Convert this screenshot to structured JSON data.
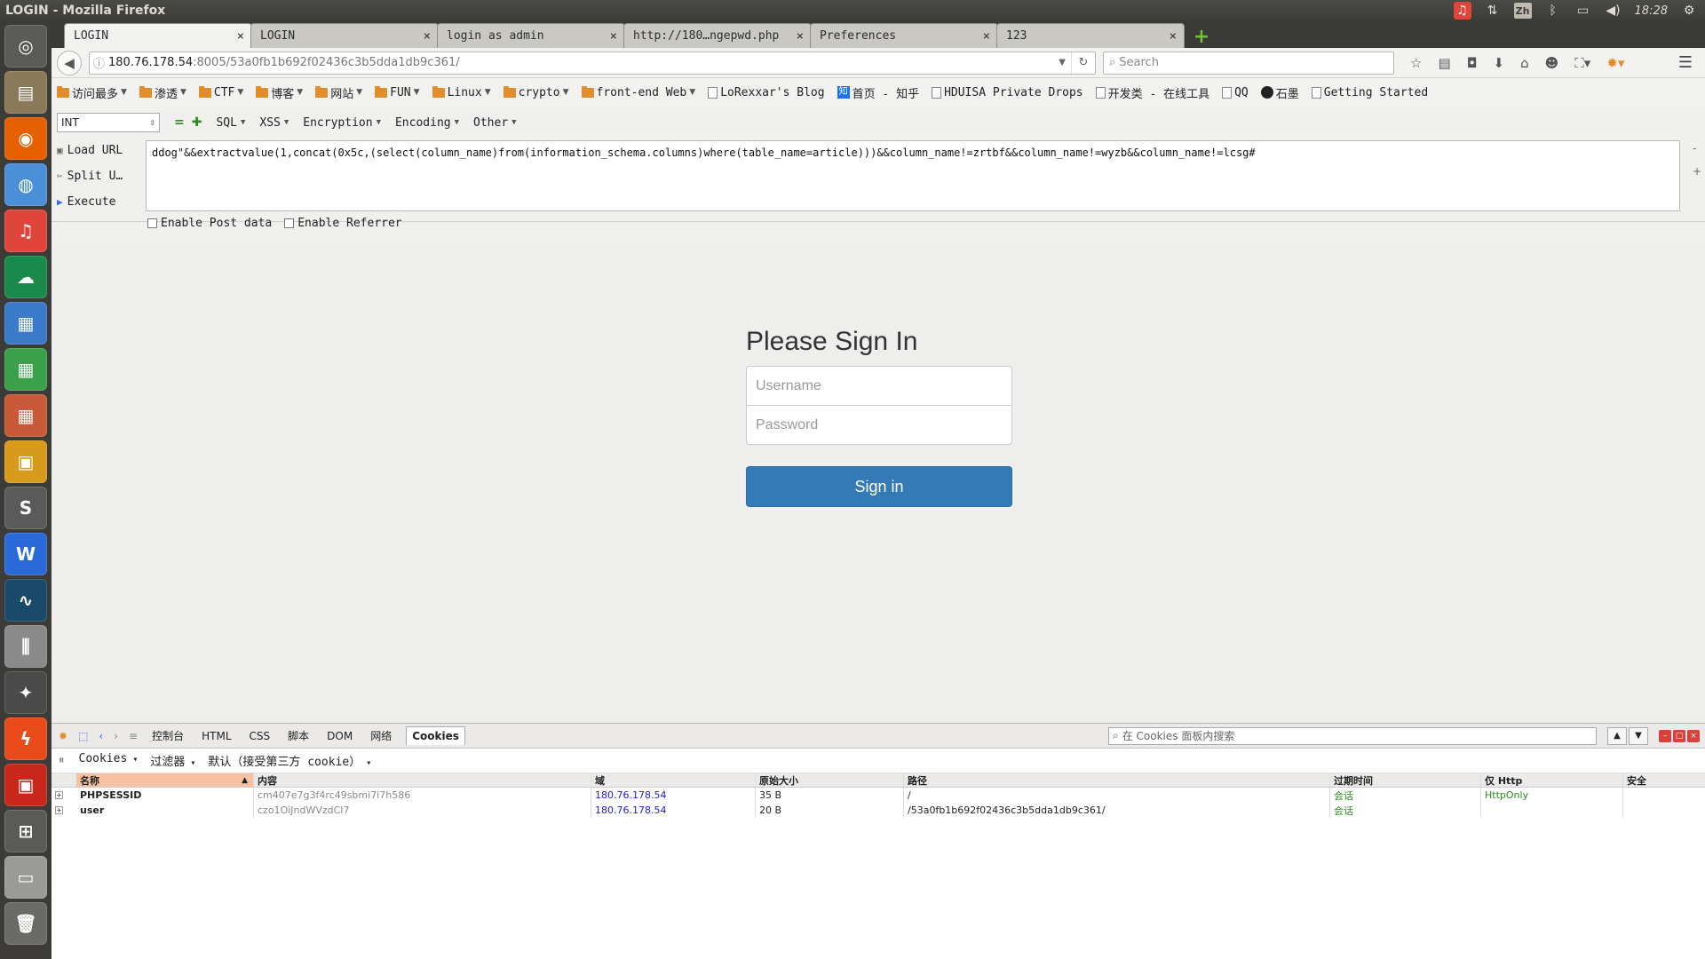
{
  "window": {
    "title": "LOGIN - Mozilla Firefox"
  },
  "tray": {
    "input_method": "Zh",
    "time": "18:28"
  },
  "tabs": [
    {
      "label": "LOGIN",
      "active": true
    },
    {
      "label": "LOGIN"
    },
    {
      "label": "login as admin"
    },
    {
      "label": "http://180…ngepwd.php"
    },
    {
      "label": "Preferences"
    },
    {
      "label": "123"
    }
  ],
  "tab_close": "×",
  "new_tab": "+",
  "navbar": {
    "url_host": "180.76.178.54",
    "url_rest": ":8005/53a0fb1b692f02436c3b5dda1db9c361/",
    "search_placeholder": "Search"
  },
  "bookmarks": [
    {
      "label": "访问最多",
      "type": "folder",
      "arrow": true
    },
    {
      "label": "渗透",
      "type": "folder",
      "arrow": true
    },
    {
      "label": "CTF",
      "type": "folder",
      "arrow": true
    },
    {
      "label": "博客",
      "type": "folder",
      "arrow": true
    },
    {
      "label": "网站",
      "type": "folder",
      "arrow": true
    },
    {
      "label": "FUN",
      "type": "folder",
      "arrow": true
    },
    {
      "label": "Linux",
      "type": "folder",
      "arrow": true
    },
    {
      "label": "crypto",
      "type": "folder",
      "arrow": true
    },
    {
      "label": "front-end Web",
      "type": "folder",
      "arrow": true
    },
    {
      "label": "LoRexxar's Blog",
      "type": "page"
    },
    {
      "label": "首页 - 知乎",
      "type": "zhihu",
      "icon_text": "知"
    },
    {
      "label": "HDUISA Private Drops",
      "type": "page"
    },
    {
      "label": "开发类 - 在线工具",
      "type": "page"
    },
    {
      "label": "QQ",
      "type": "page"
    },
    {
      "label": "石墨",
      "type": "shimo"
    },
    {
      "label": "Getting Started",
      "type": "page"
    }
  ],
  "hackbar": {
    "select_value": "INT",
    "menus": [
      "SQL",
      "XSS",
      "Encryption",
      "Encoding",
      "Other"
    ],
    "actions": [
      "Load URL",
      "Split U…",
      "Execute"
    ],
    "query": "ddog\"&&extractvalue(1,concat(0x5c,(select(column_name)from(information_schema.columns)where(table_name=article)))&&column_name!=zrtbf&&column_name!=wyzb&&column_name!=lcsg#",
    "enable_post": "Enable Post data",
    "enable_referrer": "Enable Referrer",
    "side_minus": "-",
    "side_plus": "+"
  },
  "signin": {
    "heading": "Please Sign In",
    "username_placeholder": "Username",
    "password_placeholder": "Password",
    "button": "Sign in"
  },
  "firebug": {
    "tabs": [
      "控制台",
      "HTML",
      "CSS",
      "脚本",
      "DOM",
      "网络",
      "Cookies"
    ],
    "active_tab": "Cookies",
    "search_placeholder": "在 Cookies 面板内搜索",
    "sub_menus": [
      "Cookies",
      "过滤器",
      "默认（接受第三方 cookie）"
    ],
    "columns": [
      "名称",
      "内容",
      "域",
      "原始大小",
      "路径",
      "过期时间",
      "仅 Http",
      "安全"
    ],
    "rows": [
      {
        "name": "PHPSESSID",
        "content": "cm407e7g3f4rc49sbmi7i7h586",
        "domain": "180.76.178.54",
        "size": "35 B",
        "path": "/",
        "expires": "会话",
        "httponly": "HttpOnly",
        "secure": ""
      },
      {
        "name": "user",
        "content": "czo1OiJndWVzdCI7",
        "domain": "180.76.178.54",
        "size": "20 B",
        "path": "/53a0fb1b692f02436c3b5dda1db9c361/",
        "expires": "会话",
        "httponly": "",
        "secure": ""
      }
    ]
  },
  "launcher": [
    {
      "name": "dash-icon",
      "color": "#5a5a56",
      "glyph": "◎"
    },
    {
      "name": "files-icon",
      "color": "#8a7a5a",
      "glyph": "▤"
    },
    {
      "name": "firefox-icon",
      "color": "#e66000",
      "glyph": "◉"
    },
    {
      "name": "chromium-icon",
      "color": "#4a8fd8",
      "glyph": "◍"
    },
    {
      "name": "music-icon",
      "color": "#e0453c",
      "glyph": "♫"
    },
    {
      "name": "cloud-icon",
      "color": "#1a8a4a",
      "glyph": "☁"
    },
    {
      "name": "writer-icon",
      "color": "#3a7ac8",
      "glyph": "▦"
    },
    {
      "name": "calc-icon",
      "color": "#3aa04a",
      "glyph": "▦"
    },
    {
      "name": "impress-icon",
      "color": "#c85a3a",
      "glyph": "▦"
    },
    {
      "name": "virtualbox-icon",
      "color": "#d89a1a",
      "glyph": "▣"
    },
    {
      "name": "sublime-icon",
      "color": "#5a5a5a",
      "glyph": "S"
    },
    {
      "name": "wps-icon",
      "color": "#2a6ad8",
      "glyph": "W"
    },
    {
      "name": "matlab-icon",
      "color": "#1a4a6a",
      "glyph": "∿"
    },
    {
      "name": "mixer-icon",
      "color": "#8a8a8a",
      "glyph": "⫼"
    },
    {
      "name": "inkscape-icon",
      "color": "#4a4a4a",
      "glyph": "✦"
    },
    {
      "name": "flash-icon",
      "color": "#e84a1a",
      "glyph": "ϟ"
    },
    {
      "name": "app-red-icon",
      "color": "#c8281a",
      "glyph": "▣"
    },
    {
      "name": "workspaces-icon",
      "color": "#5a5a56",
      "glyph": "⊞"
    },
    {
      "name": "drive-icon",
      "color": "#9a9a96",
      "glyph": "▭"
    },
    {
      "name": "trash-icon",
      "color": "#6a6a66",
      "glyph": "🗑"
    }
  ]
}
